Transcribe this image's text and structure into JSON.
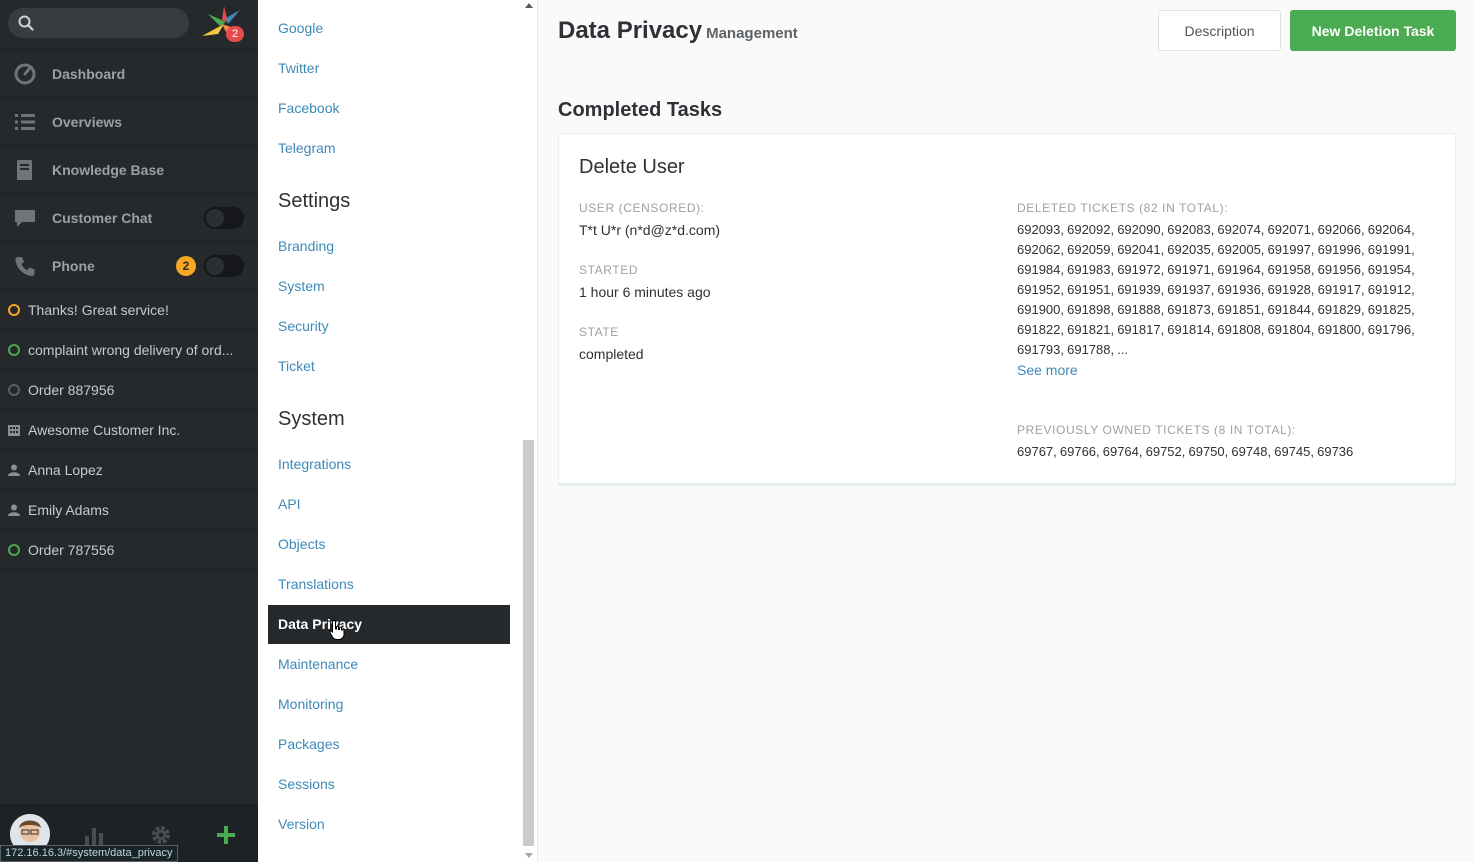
{
  "nav": {
    "search": {
      "placeholder": "",
      "value": ""
    },
    "logo_badge": "2",
    "main_items": [
      {
        "label": "Dashboard",
        "icon": "dashboard-icon"
      },
      {
        "label": "Overviews",
        "icon": "list-icon"
      },
      {
        "label": "Knowledge Base",
        "icon": "book-icon"
      },
      {
        "label": "Customer Chat",
        "icon": "chat-icon",
        "toggle": "off"
      },
      {
        "label": "Phone",
        "icon": "phone-icon",
        "badge": "2",
        "toggle": "off"
      }
    ],
    "tasks": [
      {
        "label": "Thanks! Great service!",
        "icon": "ticket-pending-icon"
      },
      {
        "label": "complaint wrong delivery of ord...",
        "icon": "ticket-open-icon"
      },
      {
        "label": "Order 887956",
        "icon": "ticket-closed-icon"
      },
      {
        "label": "Awesome Customer Inc.",
        "icon": "organization-icon"
      },
      {
        "label": "Anna Lopez",
        "icon": "user-icon"
      },
      {
        "label": "Emily Adams",
        "icon": "user-icon"
      },
      {
        "label": "Order 787556",
        "icon": "ticket-open-icon"
      }
    ],
    "url_tooltip": "172.16.16.3/#system/data_privacy"
  },
  "menu": {
    "channels": [
      "Google",
      "Twitter",
      "Facebook",
      "Telegram"
    ],
    "settings_heading": "Settings",
    "settings": [
      "Branding",
      "System",
      "Security",
      "Ticket"
    ],
    "system_heading": "System",
    "system": [
      "Integrations",
      "API",
      "Objects",
      "Translations",
      "Data Privacy",
      "Maintenance",
      "Monitoring",
      "Packages",
      "Sessions",
      "Version"
    ]
  },
  "main": {
    "title": "Data Privacy",
    "subtitle": "Management",
    "description_button": "Description",
    "new_task_button": "New Deletion Task",
    "section_title": "Completed Tasks",
    "task": {
      "title": "Delete User",
      "user_label": "USER (CENSORED):",
      "user_value": "T*t U*r (n*d@z*d.com)",
      "started_label": "STARTED",
      "started_value": "1 hour 6 minutes ago",
      "state_label": "STATE",
      "state_value": "completed",
      "deleted_label": "DELETED TICKETS (82 IN TOTAL):",
      "deleted_tickets": "692093, 692092, 692090, 692083, 692074, 692071, 692066, 692064, 692062, 692059, 692041, 692035, 692005, 691997, 691996, 691991, 691984, 691983, 691972, 691971, 691964, 691958, 691956, 691954, 691952, 691951, 691939, 691937, 691936, 691928, 691917, 691912, 691900, 691898, 691888, 691873, 691851, 691844, 691829, 691825, 691822, 691821, 691817, 691814, 691808, 691804, 691800, 691796, 691793, 691788, ...",
      "see_more": "See more",
      "owned_label": "PREVIOUSLY OWNED TICKETS (8 IN TOTAL):",
      "owned_tickets": "69767, 69766, 69764, 69752, 69750, 69748, 69745, 69736"
    }
  },
  "colors": {
    "nav_bg": "#26292c",
    "link": "#3d8ab8",
    "primary_button": "#4bab52",
    "pending": "#f6a723",
    "open": "#4bab52",
    "badge_red": "#e54b4b"
  }
}
